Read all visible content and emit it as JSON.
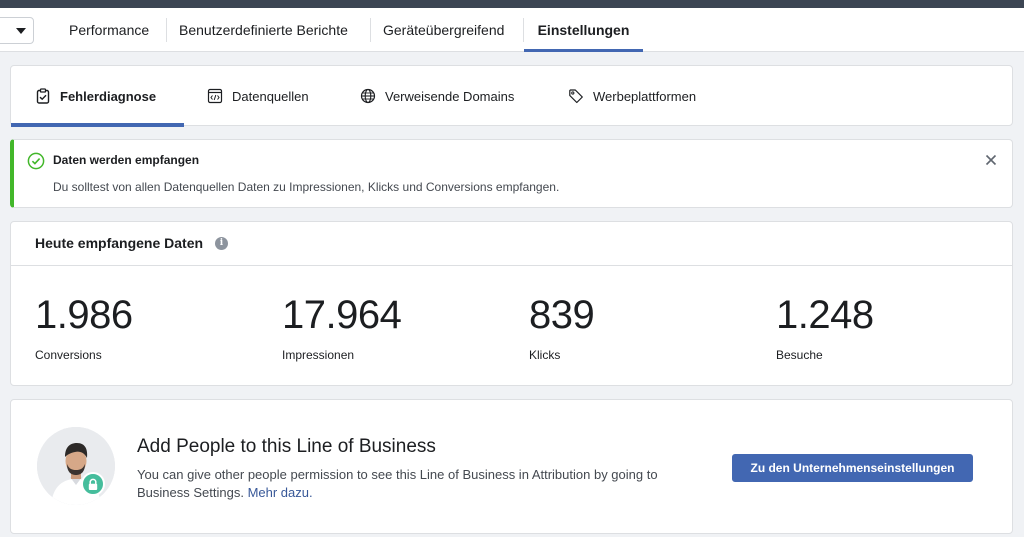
{
  "topnav": {
    "tabs": [
      {
        "label": "Performance"
      },
      {
        "label": "Benutzerdefinierte Berichte"
      },
      {
        "label": "Geräteübergreifend"
      },
      {
        "label": "Einstellungen",
        "active": true
      }
    ]
  },
  "subtabs": {
    "items": [
      {
        "label": "Fehlerdiagnose",
        "icon": "clipboard-check-icon",
        "active": true
      },
      {
        "label": "Datenquellen",
        "icon": "code-file-icon"
      },
      {
        "label": "Verweisende Domains",
        "icon": "globe-icon"
      },
      {
        "label": "Werbeplattformen",
        "icon": "tag-icon"
      }
    ]
  },
  "alert": {
    "title": "Daten werden empfangen",
    "message": "Du solltest von allen Datenquellen Daten zu Impressionen, Klicks und Conversions empfangen.",
    "status_color": "#42b72a"
  },
  "stats": {
    "title": "Heute empfangene Daten",
    "items": [
      {
        "value": "1.986",
        "label": "Conversions"
      },
      {
        "value": "17.964",
        "label": "Impressionen"
      },
      {
        "value": "839",
        "label": "Klicks"
      },
      {
        "value": "1.248",
        "label": "Besuche"
      }
    ]
  },
  "business": {
    "title": "Add People to this Line of Business",
    "description": "You can give other people permission to see this Line of Business in Attribution by going to Business Settings.",
    "link": "Mehr dazu.",
    "button": "Zu den Unternehmenseinstellungen"
  },
  "colors": {
    "accent": "#4267b2",
    "success": "#42b72a",
    "lock_badge": "#45bd9c"
  }
}
